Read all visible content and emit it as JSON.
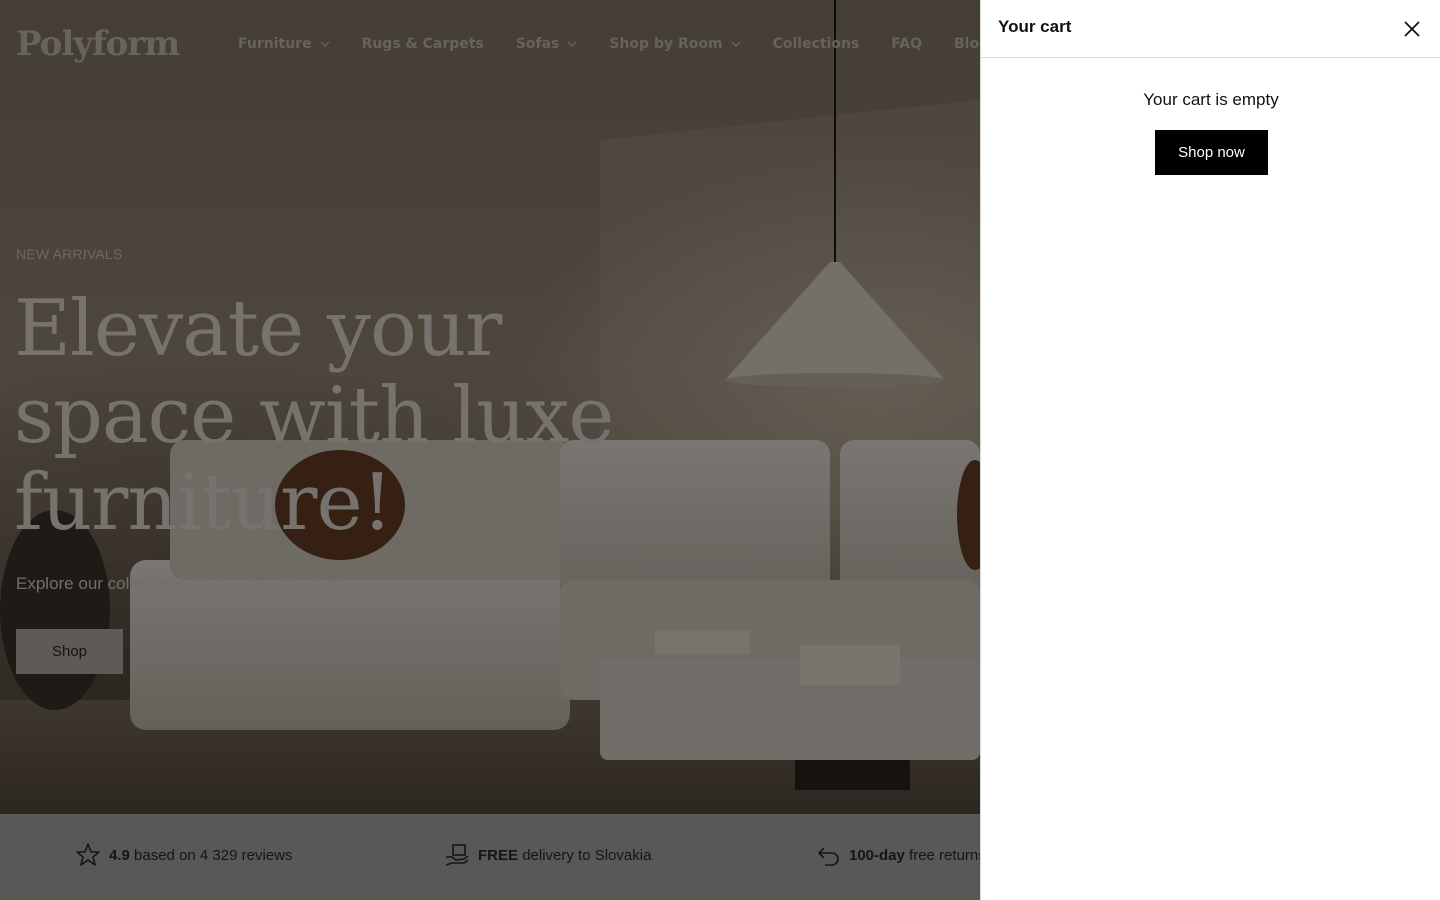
{
  "header": {
    "logo": "Polyform",
    "nav": [
      {
        "label": "Furniture",
        "has_dropdown": true
      },
      {
        "label": "Rugs & Carpets",
        "has_dropdown": false
      },
      {
        "label": "Sofas",
        "has_dropdown": true
      },
      {
        "label": "Shop by Room",
        "has_dropdown": true
      },
      {
        "label": "Collections",
        "has_dropdown": false
      },
      {
        "label": "FAQ",
        "has_dropdown": false
      },
      {
        "label": "Blog",
        "has_dropdown": false
      }
    ]
  },
  "hero": {
    "kicker": "NEW ARRIVALS",
    "title": "Elevate your space with luxe furniture!",
    "subtitle": "Explore our collections for a wider selection.",
    "button": "Shop"
  },
  "usps": [
    {
      "bold": "4.9",
      "text": "based on 4 329 reviews",
      "icon": "star-icon"
    },
    {
      "bold": "FREE",
      "text": "delivery to Slovakia",
      "icon": "delivery-icon"
    },
    {
      "bold": "100-day",
      "text": "free returns",
      "icon": "return-icon"
    }
  ],
  "cart": {
    "title": "Your cart",
    "empty_message": "Your cart is empty",
    "shop_button": "Shop now"
  },
  "colors": {
    "overlay": "#000000",
    "drawer_bg": "#ffffff",
    "primary_button": "#000000"
  }
}
